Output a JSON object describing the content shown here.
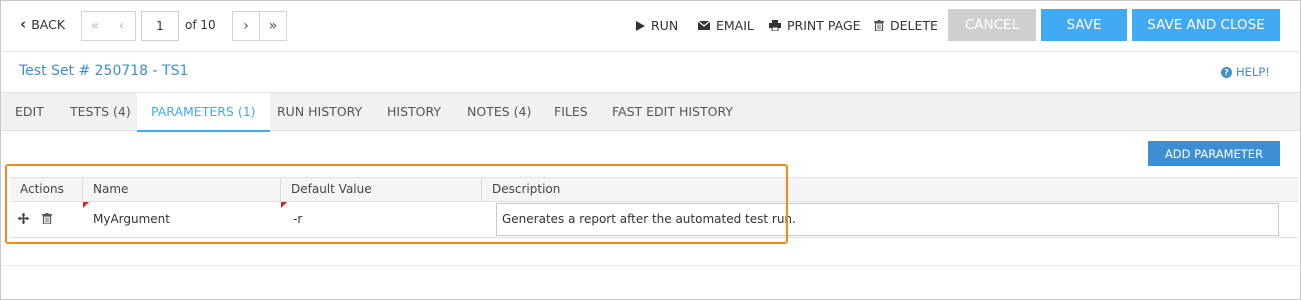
{
  "toolbar": {
    "back_label": "BACK",
    "page_current": "1",
    "page_of": "of 10",
    "run_label": "RUN",
    "email_label": "EMAIL",
    "print_label": "PRINT PAGE",
    "delete_label": "DELETE",
    "cancel_label": "CANCEL",
    "save_label": "SAVE",
    "save_close_label": "SAVE AND CLOSE"
  },
  "header": {
    "title": "Test Set # 250718 - TS1",
    "help_label": "HELP!"
  },
  "tabs": [
    {
      "label": "EDIT",
      "active": false
    },
    {
      "label": "TESTS (4)",
      "active": false
    },
    {
      "label": "PARAMETERS (1)",
      "active": true
    },
    {
      "label": "RUN HISTORY",
      "active": false
    },
    {
      "label": "HISTORY",
      "active": false
    },
    {
      "label": "NOTES (4)",
      "active": false
    },
    {
      "label": "FILES",
      "active": false
    },
    {
      "label": "FAST EDIT HISTORY",
      "active": false
    }
  ],
  "parameters": {
    "add_label": "ADD PARAMETER",
    "columns": [
      "Actions",
      "Name",
      "Default Value",
      "Description"
    ],
    "rows": [
      {
        "name": "MyArgument",
        "default_value": "-r",
        "description": "Generates a report after the automated test run."
      }
    ]
  },
  "colors": {
    "accent": "#42aaf2",
    "link": "#3e8ed4",
    "cancel": "#cfcfcf",
    "highlight": "#f28a1c",
    "required_marker": "#e02020"
  },
  "icons": {
    "back": "chevron-left-icon",
    "first": "double-chevron-left-icon",
    "prev": "chevron-left-icon",
    "next": "chevron-right-icon",
    "last": "double-chevron-right-icon",
    "run": "play-icon",
    "email": "envelope-icon",
    "print": "printer-icon",
    "delete": "trash-icon",
    "help": "question-circle-icon",
    "move": "move-arrows-icon",
    "row_delete": "trash-icon"
  }
}
